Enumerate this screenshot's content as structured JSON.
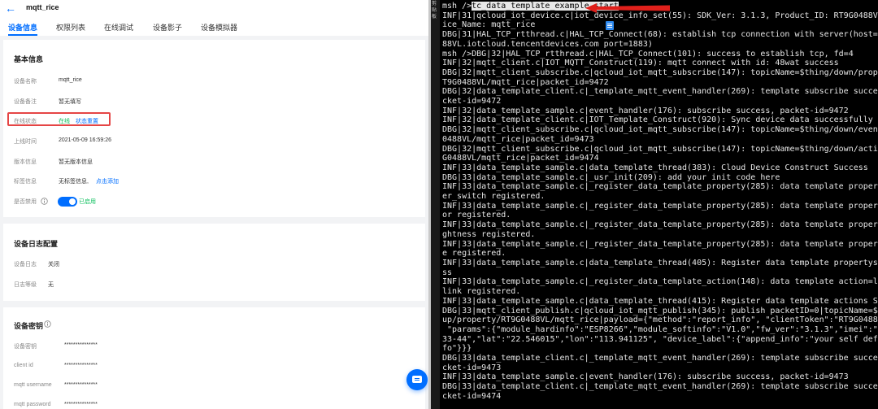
{
  "header": {
    "back_icon": "←",
    "title": "mqtt_rice"
  },
  "tabs": [
    "设备信息",
    "权限列表",
    "在线调试",
    "设备影子",
    "设备模拟器"
  ],
  "basic_info": {
    "title": "基本信息",
    "device_name_label": "设备名称",
    "device_name": "mqtt_rice",
    "remark_label": "设备备注",
    "remark": "暂无填写",
    "online_label": "在线状态",
    "online": "在线",
    "reset": "状态重置",
    "online_time_label": "上线时间",
    "online_time": "2021-05-09 16:59:26",
    "version_label": "版本信息",
    "version": "暂无版本信息",
    "tag_label": "标签信息",
    "tag": "无标签信息,",
    "tag_add": "点击添加",
    "enable_label": "是否禁用",
    "enabled_text": "已启用"
  },
  "log_config": {
    "title": "设备日志配置",
    "log_label": "设备日志",
    "log": "关闭",
    "level_label": "日志等级",
    "level": "无"
  },
  "keys": {
    "title": "设备密钥",
    "device_key_label": "设备密钥",
    "device_key": "***************",
    "client_id_label": "client id",
    "client_id": "***************",
    "username_label": "mqtt username",
    "username": "***************",
    "password_label": "mqtt password",
    "password": "***************"
  },
  "gutter": [
    "剪",
    "贴",
    "板"
  ],
  "terminal": {
    "prompt": "msh />",
    "command": "tc_data_template_example start",
    "lines": [
      "INF|31|qcloud_iot_device.c|iot_device_info_set(55): SDK_Ver: 3.1.3, Product_ID: RT9G0488VL, Dev",
      "ice_Name: mqtt_rice",
      "DBG|31|HAL_TCP_rtthread.c|HAL_TCP_Connect(68): establish tcp connection with server(host=RT9G04",
      "88VL.iotcloud.tencentdevices.com port=1883)",
      "msh />DBG|32|HAL_TCP_rtthread.c|HAL_TCP_Connect(101): success to establish tcp, fd=4",
      "INF|32|mqtt_client.c|IOT_MQTT_Construct(119): mqtt connect with id: 48wat success",
      "DBG|32|mqtt_client_subscribe.c|qcloud_iot_mqtt_subscribe(147): topicName=$thing/down/property/R",
      "T9G0488VL/mqtt_rice|packet_id=9472",
      "DBG|32|data_template_client.c|_template_mqtt_event_handler(269): template subscribe success, pa",
      "cket-id=9472",
      "INF|32|data_template_sample.c|event_handler(176): subscribe success, packet-id=9472",
      "INF|32|data_template_client.c|IOT_Template_Construct(920): Sync device data successfully",
      "DBG|32|mqtt_client_subscribe.c|qcloud_iot_mqtt_subscribe(147): topicName=$thing/down/event/RT9G",
      "0488VL/mqtt_rice|packet_id=9473",
      "DBG|32|mqtt_client_subscribe.c|qcloud_iot_mqtt_subscribe(147): topicName=$thing/down/action/RT9",
      "G0488VL/mqtt_rice|packet_id=9474",
      "INF|33|data_template_sample.c|data_template_thread(383): Cloud Device Construct Success",
      "DBG|33|data_template_sample.c|_usr_init(209): add your init code here",
      "INF|33|data_template_sample.c|_register_data_template_property(285): data template property=pow",
      "er_switch registered.",
      "INF|33|data_template_sample.c|_register_data_template_property(285): data template property=col",
      "or registered.",
      "INF|33|data_template_sample.c|_register_data_template_property(285): data template property=bri",
      "ghtness registered.",
      "INF|33|data_template_sample.c|_register_data_template_property(285): data template property=nam",
      "e registered.",
      "INF|33|data_template_sample.c|data_template_thread(405): Register data template propertys Succe",
      "ss",
      "INF|33|data_template_sample.c|_register_data_template_action(148): data template action=light_b",
      "link registered.",
      "INF|33|data_template_sample.c|data_template_thread(415): Register data template actions Success",
      "DBG|33|mqtt_client_publish.c|qcloud_iot_mqtt_publish(345): publish packetID=0|topicName=$thing/",
      "up/property/RT9G0488VL/mqtt_rice|payload={\"method\":\"report_info\", \"clientToken\":\"RT9G0488VL-0\",",
      " \"params\":{\"module_hardinfo\":\"ESP8266\",\"module_softinfo\":\"V1.0\",\"fw_ver\":\"3.1.3\",\"imei\":\"11-22-",
      "33-44\",\"lat\":\"22.546015\",\"lon\":\"113.941125\", \"device_label\":{\"append_info\":\"your self define in",
      "fo\"}}}",
      "DBG|33|data_template_client.c|_template_mqtt_event_handler(269): template subscribe success, pa",
      "cket-id=9473",
      "INF|33|data_template_sample.c|event_handler(176): subscribe success, packet-id=9473",
      "DBG|33|data_template_client.c|_template_mqtt_event_handler(269): template subscribe success, pa",
      "cket-id=9474"
    ]
  },
  "colors": {
    "accent": "#006eff",
    "success": "#0abf5b",
    "highlight_box": "#e54545",
    "terminal_bg": "#000000"
  },
  "icons": {
    "back": "back-arrow-icon",
    "info": "info-circle-icon",
    "chat": "chat-icon",
    "arrow": "red-arrow-icon",
    "file": "file-icon"
  }
}
